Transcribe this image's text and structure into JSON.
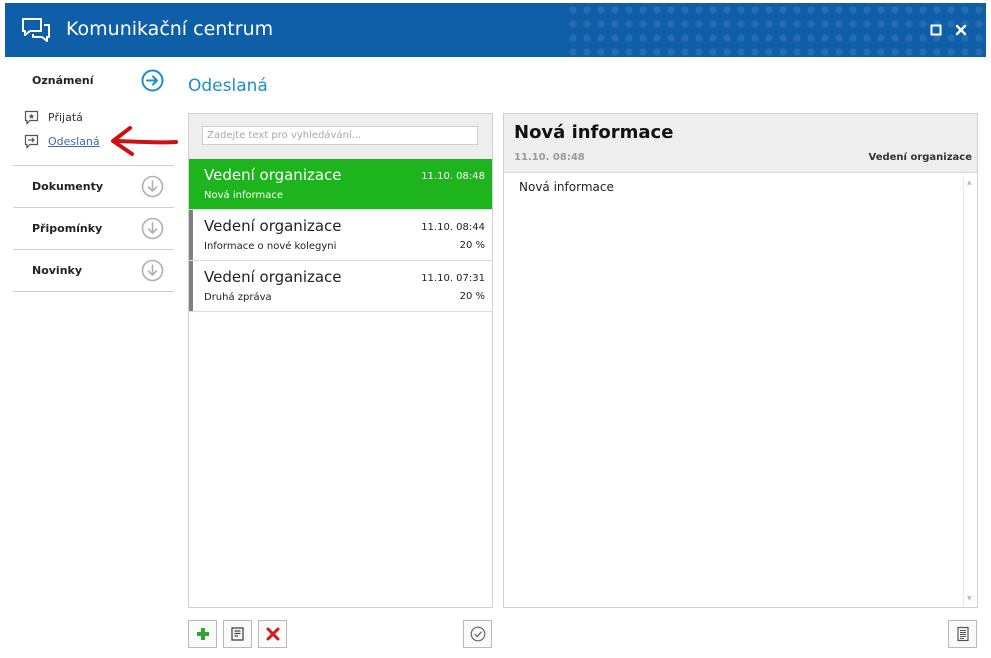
{
  "window": {
    "title": "Komunikační centrum",
    "accent_color": "#0f5fa8",
    "controls": [
      "maximize-icon",
      "close-icon"
    ]
  },
  "sidebar": {
    "sections": [
      {
        "label": "Oznámení",
        "icon": "arrow-right-circle-icon",
        "expanded": true,
        "items": [
          {
            "label": "Přijatá",
            "icon": "inbox-star-icon",
            "active": false
          },
          {
            "label": "Odeslaná",
            "icon": "outbox-arrow-icon",
            "active": true
          }
        ]
      },
      {
        "label": "Dokumenty",
        "icon": "arrow-down-circle-icon",
        "expanded": false
      },
      {
        "label": "Připomínky",
        "icon": "arrow-down-circle-icon",
        "expanded": false
      },
      {
        "label": "Novinky",
        "icon": "arrow-down-circle-icon",
        "expanded": false
      }
    ]
  },
  "main": {
    "title": "Odeslaná",
    "search": {
      "placeholder": "Zadejte text pro vyhledávání...",
      "value": ""
    },
    "messages": [
      {
        "sender": "Vedení organizace",
        "time": "11.10. 08:48",
        "subject": "Nová informace",
        "percent": "",
        "selected": true
      },
      {
        "sender": "Vedení organizace",
        "time": "11.10. 08:44",
        "subject": "Informace o nové kolegyni",
        "percent": "20 %",
        "selected": false
      },
      {
        "sender": "Vedení organizace",
        "time": "11.10. 07:31",
        "subject": "Druhá zpráva",
        "percent": "20 %",
        "selected": false
      }
    ],
    "selected_color": "#1eb41e"
  },
  "detail": {
    "title": "Nová informace",
    "date": "11.10. 08:48",
    "sender": "Vedení organizace",
    "body": "Nová informace"
  },
  "toolbar": {
    "buttons": [
      "add-icon",
      "edit-note-icon",
      "delete-icon",
      "mark-read-icon",
      "document-icon"
    ]
  },
  "annotation": {
    "arrow_color": "#cc1111"
  }
}
